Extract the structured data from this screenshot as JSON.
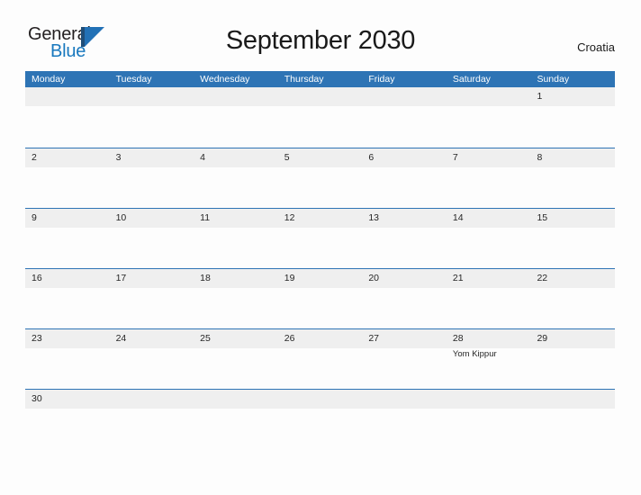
{
  "brand": {
    "name_part1": "General",
    "name_part2": "Blue",
    "mark_icon": "triangle-flag-icon"
  },
  "header": {
    "title": "September 2030",
    "region": "Croatia"
  },
  "colors": {
    "header_blue": "#2e74b5",
    "band_gray": "#efefef",
    "page_background": "#fdfdfd",
    "brand_blue": "#1878be",
    "text": "#262626"
  },
  "calendar": {
    "month": "September",
    "year": "2030",
    "week_start": "Monday",
    "day_headers": [
      "Monday",
      "Tuesday",
      "Wednesday",
      "Thursday",
      "Friday",
      "Saturday",
      "Sunday"
    ],
    "weeks": [
      [
        {
          "num": "",
          "events": []
        },
        {
          "num": "",
          "events": []
        },
        {
          "num": "",
          "events": []
        },
        {
          "num": "",
          "events": []
        },
        {
          "num": "",
          "events": []
        },
        {
          "num": "",
          "events": []
        },
        {
          "num": "1",
          "events": []
        }
      ],
      [
        {
          "num": "2",
          "events": []
        },
        {
          "num": "3",
          "events": []
        },
        {
          "num": "4",
          "events": []
        },
        {
          "num": "5",
          "events": []
        },
        {
          "num": "6",
          "events": []
        },
        {
          "num": "7",
          "events": []
        },
        {
          "num": "8",
          "events": []
        }
      ],
      [
        {
          "num": "9",
          "events": []
        },
        {
          "num": "10",
          "events": []
        },
        {
          "num": "11",
          "events": []
        },
        {
          "num": "12",
          "events": []
        },
        {
          "num": "13",
          "events": []
        },
        {
          "num": "14",
          "events": []
        },
        {
          "num": "15",
          "events": []
        }
      ],
      [
        {
          "num": "16",
          "events": []
        },
        {
          "num": "17",
          "events": []
        },
        {
          "num": "18",
          "events": []
        },
        {
          "num": "19",
          "events": []
        },
        {
          "num": "20",
          "events": []
        },
        {
          "num": "21",
          "events": []
        },
        {
          "num": "22",
          "events": []
        }
      ],
      [
        {
          "num": "23",
          "events": []
        },
        {
          "num": "24",
          "events": []
        },
        {
          "num": "25",
          "events": []
        },
        {
          "num": "26",
          "events": []
        },
        {
          "num": "27",
          "events": []
        },
        {
          "num": "28",
          "events": [
            "Yom Kippur"
          ]
        },
        {
          "num": "29",
          "events": []
        }
      ],
      [
        {
          "num": "30",
          "events": []
        },
        {
          "num": "",
          "events": []
        },
        {
          "num": "",
          "events": []
        },
        {
          "num": "",
          "events": []
        },
        {
          "num": "",
          "events": []
        },
        {
          "num": "",
          "events": []
        },
        {
          "num": "",
          "events": []
        }
      ]
    ]
  }
}
